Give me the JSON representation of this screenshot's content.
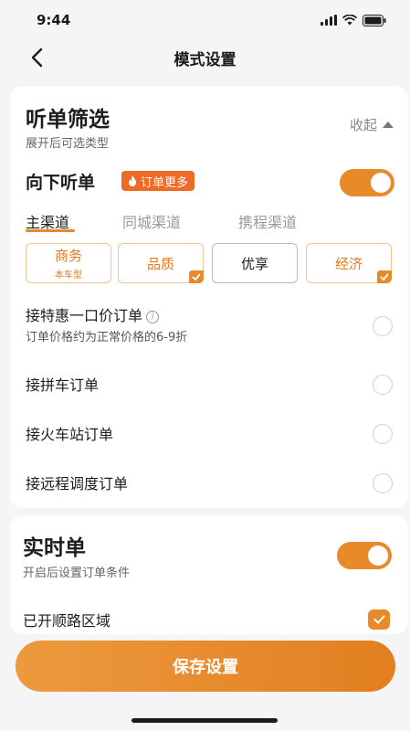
{
  "status_bar": {
    "time": "9:44"
  },
  "nav": {
    "title": "模式设置"
  },
  "filter_card": {
    "title": "听单筛选",
    "subtitle": "展开后可选类型",
    "collapse_label": "收起",
    "downward": {
      "label": "向下听单",
      "badge": "订单更多",
      "enabled": true
    },
    "tabs": [
      {
        "label": "主渠道",
        "active": true
      },
      {
        "label": "同城渠道",
        "active": false
      },
      {
        "label": "携程渠道",
        "active": false
      }
    ],
    "categories": [
      {
        "label": "商务",
        "sub": "本车型",
        "selected": false
      },
      {
        "label": "品质",
        "selected": true
      },
      {
        "label": "优享",
        "selected": false
      },
      {
        "label": "经济",
        "selected": true
      }
    ],
    "options": [
      {
        "label": "接特惠一口价订单",
        "desc": "订单价格约为正常价格的6-9折",
        "info_icon": "info-icon",
        "checked": false
      },
      {
        "label": "接拼车订单",
        "checked": false
      },
      {
        "label": "接火车站订单",
        "checked": false
      },
      {
        "label": "接远程调度订单",
        "checked": false
      }
    ]
  },
  "realtime_card": {
    "title": "实时单",
    "subtitle": "开启后设置订单条件",
    "enabled": true,
    "route_area": {
      "label": "已开顺路区域",
      "checked": true
    }
  },
  "save_button": {
    "label": "保存设置"
  },
  "colors": {
    "accent": "#e98a2a",
    "badge": "#ef6a26"
  }
}
